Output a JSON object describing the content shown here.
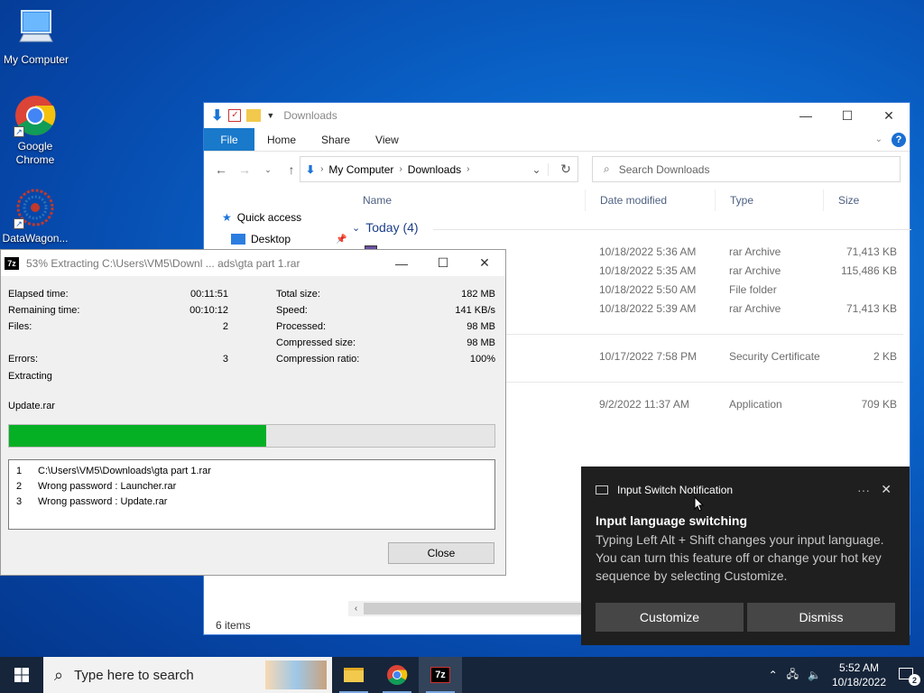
{
  "desktop": {
    "icons": [
      {
        "label": "My Computer"
      },
      {
        "label": "Google Chrome"
      },
      {
        "label": "DataWagon..."
      }
    ]
  },
  "explorer": {
    "title": "Downloads",
    "ribbon_tabs": [
      "File",
      "Home",
      "Share",
      "View"
    ],
    "address": {
      "crumbs": [
        "My Computer",
        "Downloads"
      ]
    },
    "search_placeholder": "Search Downloads",
    "nav": {
      "quick_access": "Quick access",
      "desktop": "Desktop"
    },
    "columns": {
      "name": "Name",
      "date": "Date modified",
      "type": "Type",
      "size": "Size"
    },
    "group": "Today (4)",
    "files": [
      {
        "date": "10/18/2022 5:36 AM",
        "type": "rar Archive",
        "size": "71,413 KB"
      },
      {
        "date": "10/18/2022 5:35 AM",
        "type": "rar Archive",
        "size": "115,486 KB"
      },
      {
        "date": "10/18/2022 5:50 AM",
        "type": "File folder",
        "size": ""
      },
      {
        "date": "10/18/2022 5:39 AM",
        "type": "rar Archive",
        "size": "71,413 KB"
      },
      {
        "date": "10/17/2022 7:58 PM",
        "type": "Security Certificate",
        "size": "2 KB"
      },
      {
        "date": "9/2/2022 11:37 AM",
        "type": "Application",
        "size": "709 KB"
      }
    ],
    "status": "6 items"
  },
  "zip": {
    "title": "53% Extracting C:\\Users\\VM5\\Downl ... ads\\gta part 1.rar",
    "left_stats": [
      {
        "label": "Elapsed time:",
        "value": "00:11:51"
      },
      {
        "label": "Remaining time:",
        "value": "00:10:12"
      },
      {
        "label": "Files:",
        "value": "2"
      },
      {
        "label": "",
        "value": ""
      },
      {
        "label": "Errors:",
        "value": "3"
      }
    ],
    "right_stats": [
      {
        "label": "Total size:",
        "value": "182 MB"
      },
      {
        "label": "Speed:",
        "value": "141 KB/s"
      },
      {
        "label": "Processed:",
        "value": "98 MB"
      },
      {
        "label": "Compressed size:",
        "value": "98 MB"
      },
      {
        "label": "Compression ratio:",
        "value": "100%"
      }
    ],
    "action": "Extracting",
    "current_file": "Update.rar",
    "progress": 0.53,
    "log": [
      {
        "n": "1",
        "text": "C:\\Users\\VM5\\Downloads\\gta part 1.rar"
      },
      {
        "n": "2",
        "text": "Wrong password : Launcher.rar"
      },
      {
        "n": "3",
        "text": "Wrong password : Update.rar"
      }
    ],
    "close_label": "Close"
  },
  "toast": {
    "header": "Input Switch Notification",
    "title": "Input language switching",
    "body": "Typing Left Alt + Shift changes your input language. You can turn this feature off or change your hot key sequence by selecting Customize.",
    "customize": "Customize",
    "dismiss": "Dismiss"
  },
  "taskbar": {
    "search_placeholder": "Type here to search",
    "time": "5:52 AM",
    "date": "10/18/2022",
    "notification_count": "2"
  },
  "colors": {
    "accent": "#1979ca",
    "progress": "#06b025",
    "taskbar": "#16253a"
  }
}
